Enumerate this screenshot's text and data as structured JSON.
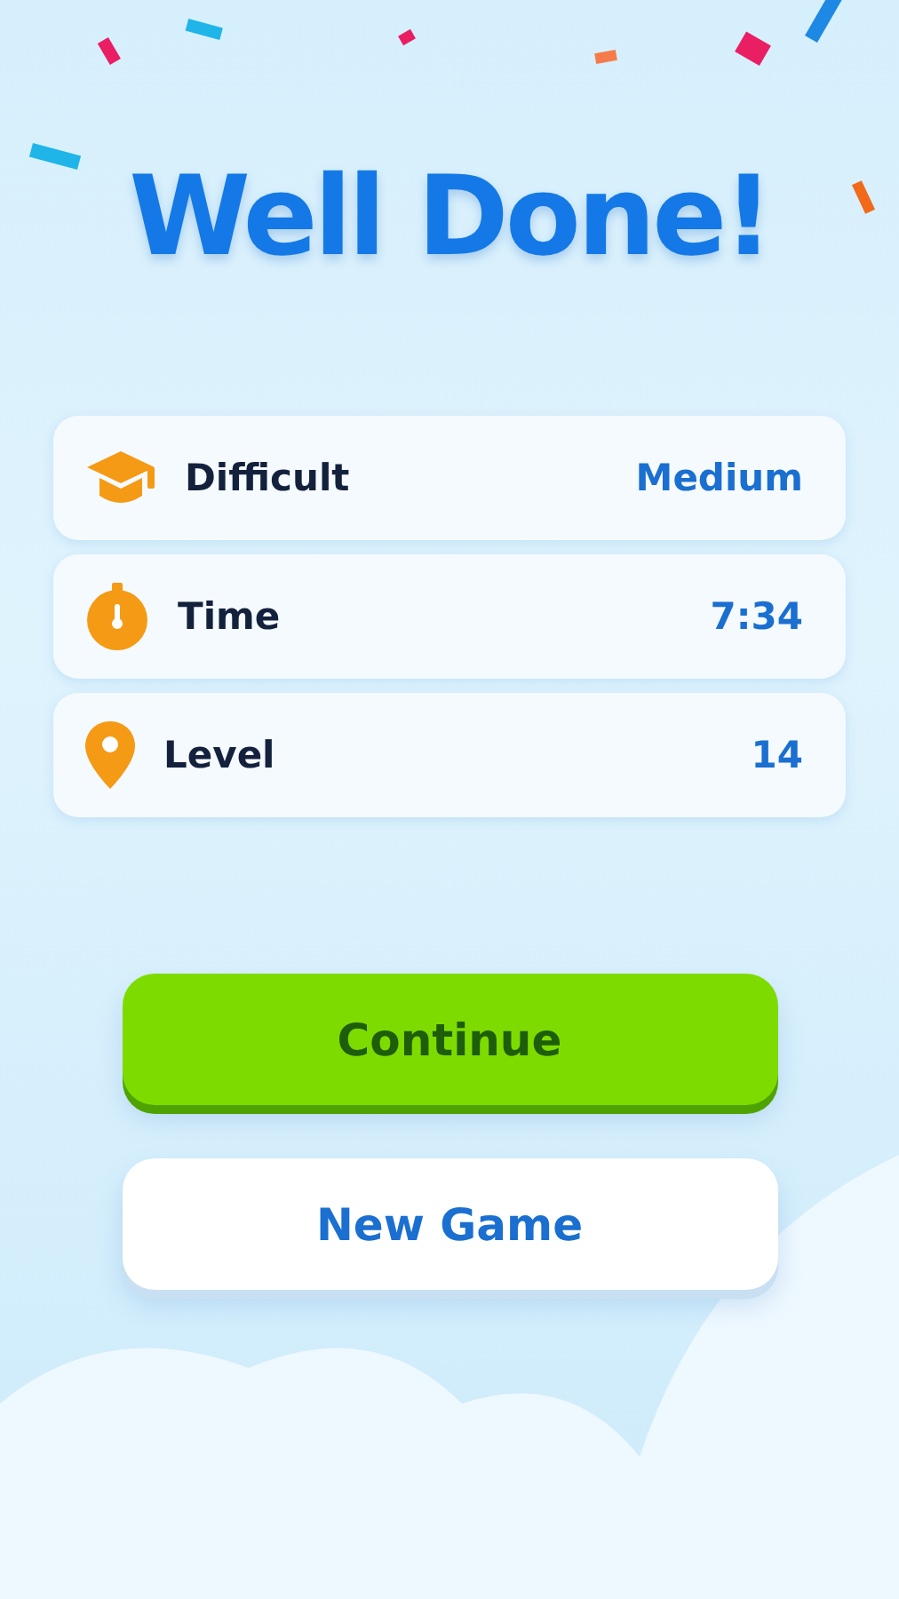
{
  "title": "Well Done!",
  "stats": [
    {
      "kind": "cap",
      "label": "Difficult",
      "value": "Medium"
    },
    {
      "kind": "timer",
      "label": "Time",
      "value": "7:34"
    },
    {
      "kind": "pin",
      "label": "Level",
      "value": "14"
    }
  ],
  "buttons": [
    {
      "kind": "primary",
      "label": "Continue"
    },
    {
      "kind": "secondary",
      "label": "New Game"
    }
  ]
}
